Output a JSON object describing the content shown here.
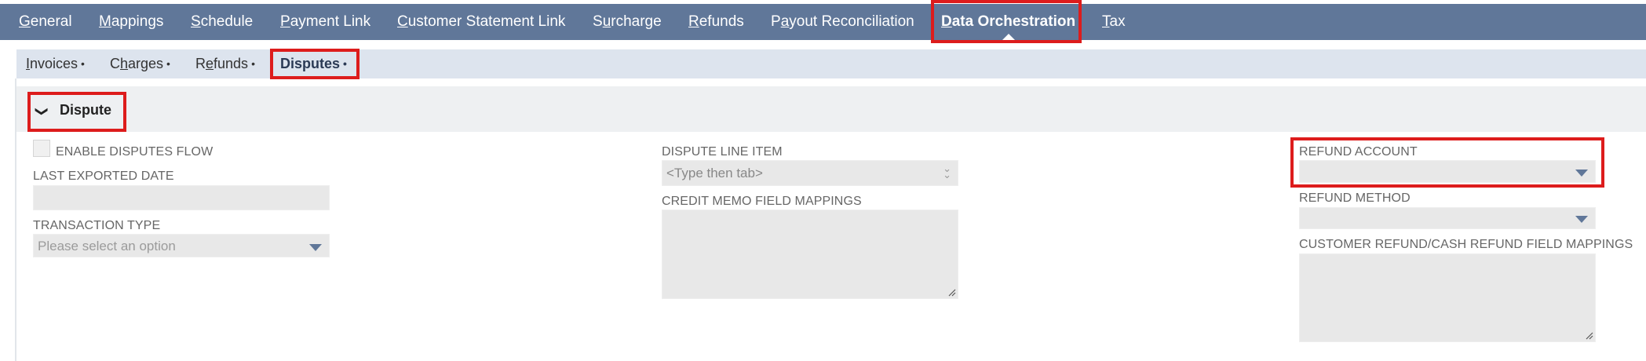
{
  "top_tabs": [
    {
      "pre": "",
      "key": "G",
      "post": "eneral"
    },
    {
      "pre": "",
      "key": "M",
      "post": "appings"
    },
    {
      "pre": "",
      "key": "S",
      "post": "chedule"
    },
    {
      "pre": "",
      "key": "P",
      "post": "ayment Link"
    },
    {
      "pre": "",
      "key": "C",
      "post": "ustomer Statement Link"
    },
    {
      "pre": "S",
      "key": "u",
      "post": "rcharge"
    },
    {
      "pre": "",
      "key": "R",
      "post": "efunds"
    },
    {
      "pre": "P",
      "key": "a",
      "post": "yout Reconciliation"
    },
    {
      "pre": "",
      "key": "D",
      "post": "ata Orchestration"
    },
    {
      "pre": "",
      "key": "T",
      "post": "ax"
    }
  ],
  "sub_tabs": [
    {
      "pre": "",
      "key": "I",
      "post": "nvoices",
      "dot": "•"
    },
    {
      "pre": "C",
      "key": "h",
      "post": "arges",
      "dot": "•"
    },
    {
      "pre": "R",
      "key": "e",
      "post": "funds",
      "dot": "•"
    },
    {
      "pre": "",
      "key": "",
      "post": "Disputes",
      "dot": "•"
    }
  ],
  "section": {
    "chevron": "❯",
    "title": "Dispute"
  },
  "fields": {
    "enable_disputes_flow": "ENABLE DISPUTES FLOW",
    "last_exported_date": "LAST EXPORTED DATE",
    "transaction_type": "TRANSACTION TYPE",
    "transaction_type_placeholder": "Please select an option",
    "dispute_line_item": "DISPUTE LINE ITEM",
    "dispute_line_item_placeholder": "<Type then tab>",
    "credit_memo_field_mappings": "CREDIT MEMO FIELD MAPPINGS",
    "refund_account": "REFUND ACCOUNT",
    "refund_method": "REFUND METHOD",
    "customer_refund_mappings": "CUSTOMER REFUND/CASH REFUND FIELD MAPPINGS"
  },
  "colors": {
    "nav_bg": "#607799",
    "highlight": "#dd1c1c",
    "field_bg": "#e8e8e8"
  }
}
